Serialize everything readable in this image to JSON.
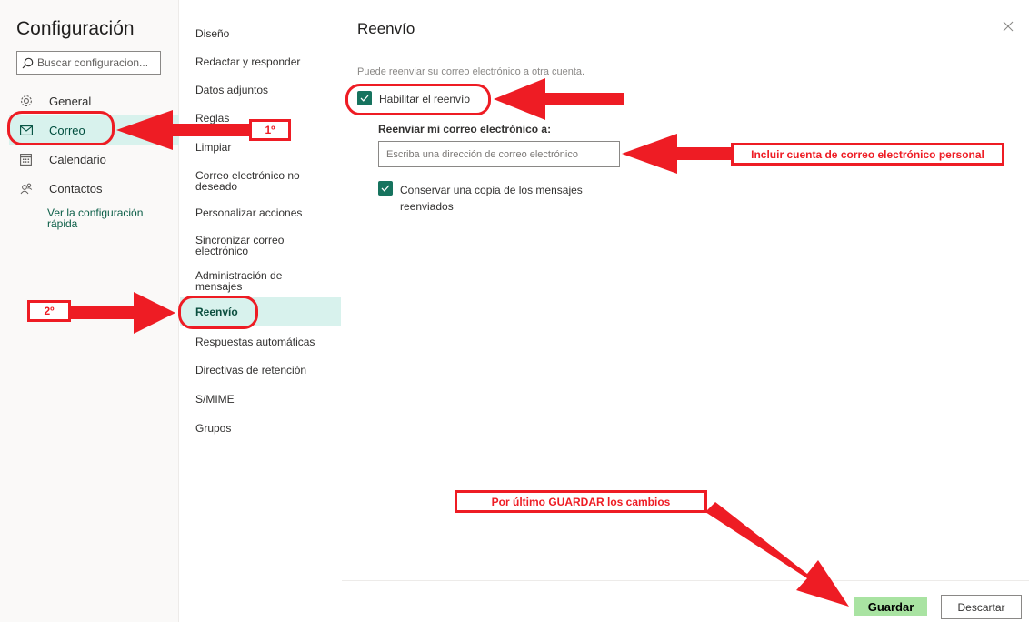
{
  "settings": {
    "title": "Configuración",
    "search_placeholder": "Buscar configuracion..."
  },
  "nav_primary": [
    {
      "label": "General",
      "icon": "gear-icon"
    },
    {
      "label": "Correo",
      "icon": "mail-icon",
      "selected": true
    },
    {
      "label": "Calendario",
      "icon": "calendar-icon"
    },
    {
      "label": "Contactos",
      "icon": "contacts-icon"
    }
  ],
  "quick_config_link": "Ver la configuración rápida",
  "nav_secondary": [
    "Diseño",
    "Redactar y responder",
    "Datos adjuntos",
    "Reglas",
    "Limpiar",
    "Correo electrónico no deseado",
    "Personalizar acciones",
    "Sincronizar correo electrónico",
    "Administración de mensajes",
    "Reenvío",
    "Respuestas automáticas",
    "Directivas de retención",
    "S/MIME",
    "Grupos"
  ],
  "forwarding": {
    "title": "Reenvío",
    "description": "Puede reenviar su correo electrónico a otra cuenta.",
    "enable_label": "Habilitar el reenvío",
    "enable_checked": true,
    "forward_to_label": "Reenviar mi correo electrónico a:",
    "email_placeholder": "Escriba una dirección de correo electrónico",
    "email_value": "",
    "keep_copy_label": "Conservar una copia de los mensajes reenviados",
    "keep_copy_checked": true
  },
  "footer": {
    "save_label": "Guardar",
    "discard_label": "Descartar"
  },
  "annotations": {
    "step1": "1º",
    "step2": "2º",
    "email_note": "Incluir cuenta de correo electrónico personal",
    "save_note": "Por último GUARDAR los cambios"
  },
  "colors": {
    "accent": "#16735e",
    "selected_bg": "#d8f2ed",
    "annotation_red": "#ee1c24",
    "save_highlight": "#a9e3a2"
  }
}
